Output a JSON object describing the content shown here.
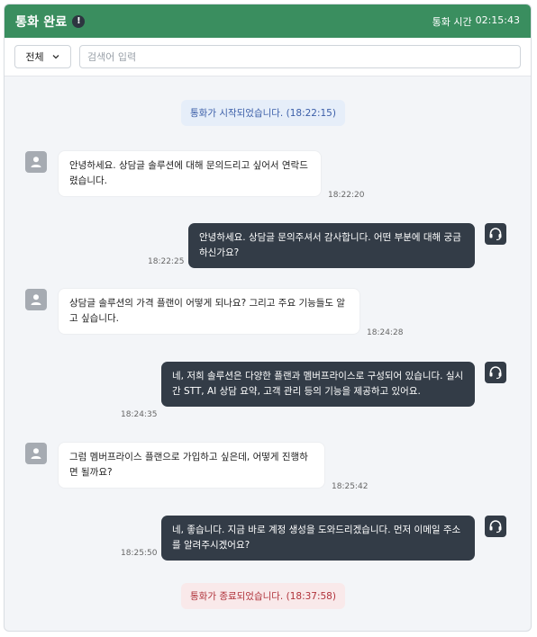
{
  "header": {
    "title": "통화 완료",
    "duration_label": "통화 시간",
    "duration_value": "02:15:43"
  },
  "toolbar": {
    "filter_label": "전체",
    "search_placeholder": "검색어 입력"
  },
  "system_messages": {
    "start": "통화가 시작되었습니다. (18:22:15)",
    "end": "통화가 종료되었습니다. (18:37:58)"
  },
  "messages": [
    {
      "role": "customer",
      "text": "안녕하세요. 상담글 솔루션에 대해 문의드리고 싶어서 연락드렸습니다.",
      "time": "18:22:20"
    },
    {
      "role": "agent",
      "text": "안녕하세요. 상담글 문의주셔서 감사합니다. 어떤 부분에 대해 궁금하신가요?",
      "time": "18:22:25"
    },
    {
      "role": "customer",
      "text": "상담글 솔루션의 가격 플랜이 어떻게 되나요? 그리고 주요 기능들도 알고 싶습니다.",
      "time": "18:24:28"
    },
    {
      "role": "agent",
      "text": "네, 저희 솔루션은 다양한 플랜과 멤버프라이스로 구성되어 있습니다. 실시간 STT, AI 상담 요약, 고객 관리 등의 기능을 제공하고 있어요.",
      "time": "18:24:35"
    },
    {
      "role": "customer",
      "text": "그럼 멤버프라이스 플랜으로 가입하고 싶은데, 어떻게 진행하면 될까요?",
      "time": "18:25:42"
    },
    {
      "role": "agent",
      "text": "네, 좋습니다. 지금 바로 계정 생성을 도와드리겠습니다. 먼저 이메일 주소를 알려주시겠어요?",
      "time": "18:25:50"
    }
  ]
}
